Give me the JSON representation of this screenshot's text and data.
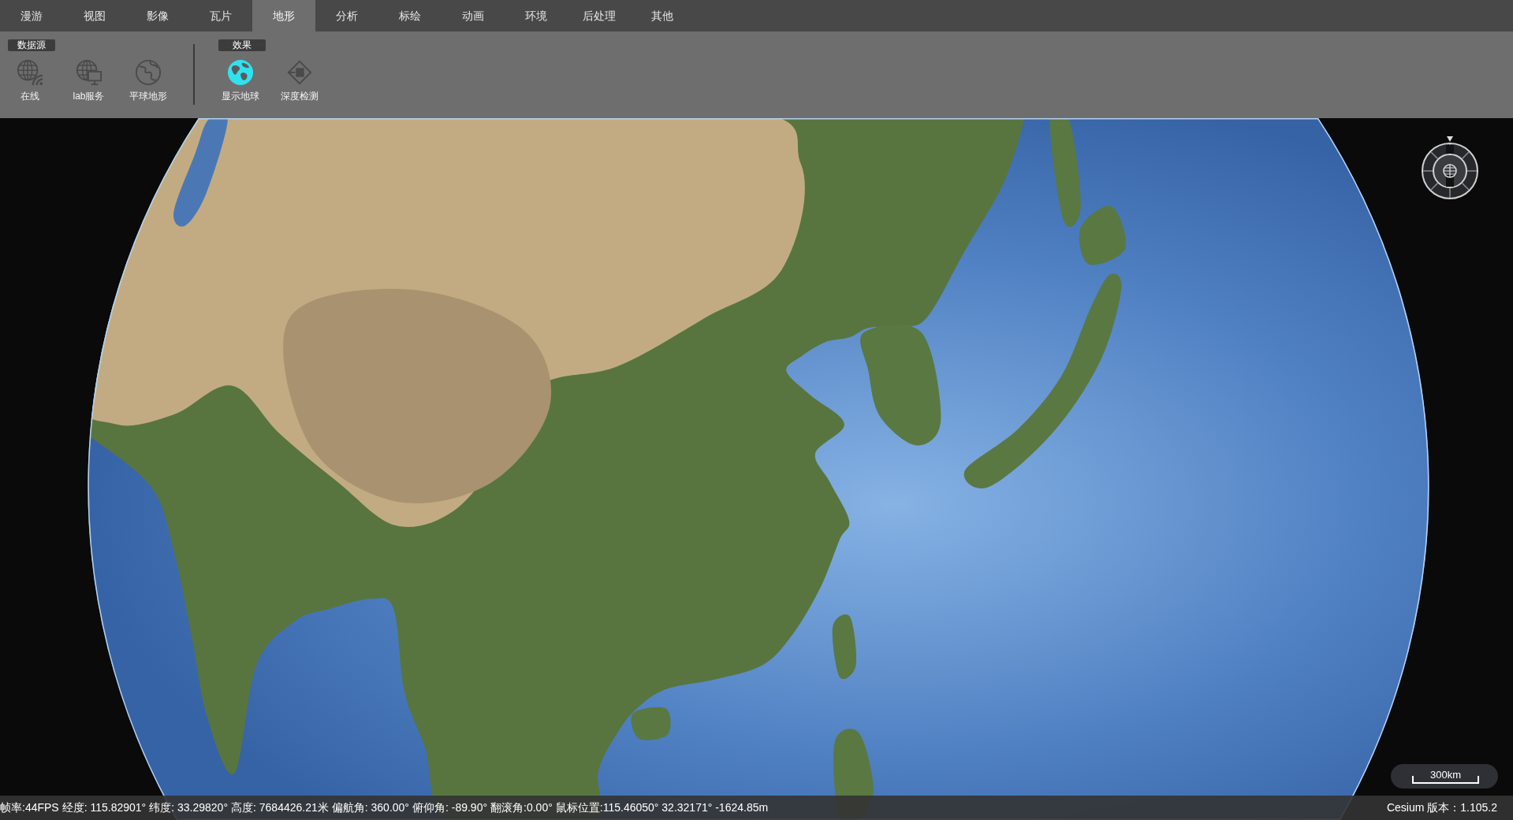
{
  "menu_tabs": [
    {
      "label": "漫游",
      "selected": false
    },
    {
      "label": "视图",
      "selected": false
    },
    {
      "label": "影像",
      "selected": false
    },
    {
      "label": "瓦片",
      "selected": false
    },
    {
      "label": "地形",
      "selected": true
    },
    {
      "label": "分析",
      "selected": false
    },
    {
      "label": "标绘",
      "selected": false
    },
    {
      "label": "动画",
      "selected": false
    },
    {
      "label": "环境",
      "selected": false
    },
    {
      "label": "后处理",
      "selected": false
    },
    {
      "label": "其他",
      "selected": false
    }
  ],
  "toolbar": {
    "groups": [
      {
        "title": "数据源",
        "tools": [
          {
            "label": "在线",
            "on": false
          },
          {
            "label": "lab服务",
            "on": false
          },
          {
            "label": "平球地形",
            "on": false
          }
        ]
      },
      {
        "title": "效果",
        "tools": [
          {
            "label": "显示地球",
            "on": true
          },
          {
            "label": "深度检测",
            "on": false
          }
        ]
      }
    ]
  },
  "scale_bar": {
    "label": "300km"
  },
  "status_bar": {
    "readouts": [
      "帧率:44FPS",
      "经度: 115.82901°",
      "纬度: 33.29820°",
      "高度: 7684426.21米",
      "偏航角: 360.00°",
      "俯仰角: -89.90°",
      "翻滚角:0.00°",
      "鼠标位置:115.46050° 32.32171° -1624.85m"
    ],
    "version": "Cesium 版本：1.105.2"
  }
}
